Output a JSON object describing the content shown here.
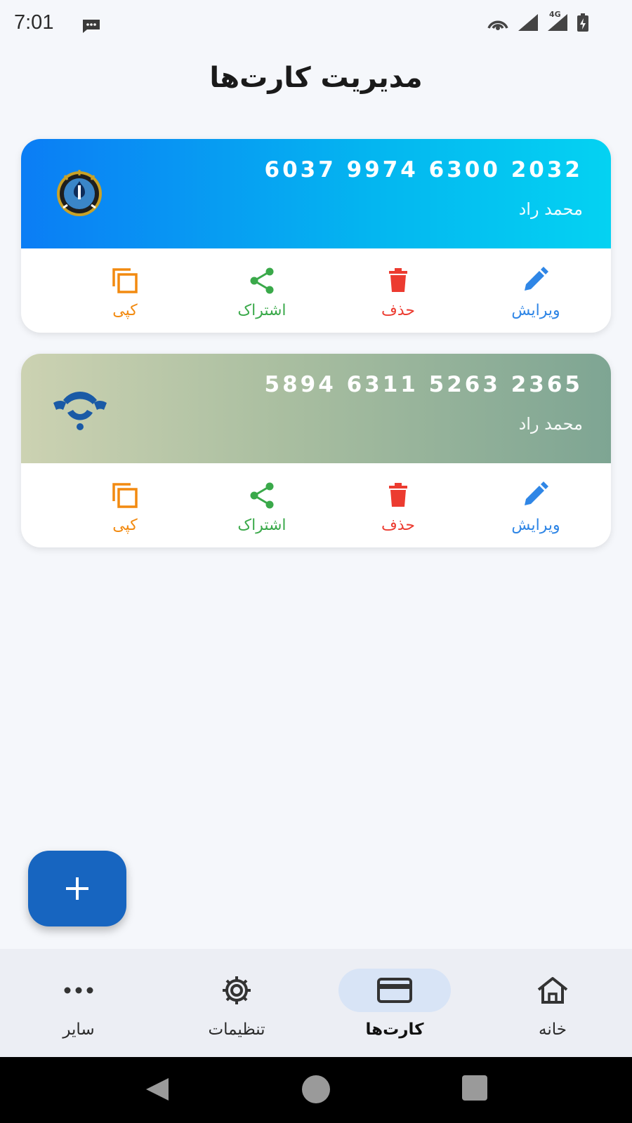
{
  "status_bar": {
    "time": "7:01",
    "network": "4G"
  },
  "page": {
    "title": "مدیریت کارت‌ها"
  },
  "cards": [
    {
      "number": "6037 9974 6300 2032",
      "holder": "محمد راد",
      "bank_logo": "bank-melli-logo"
    },
    {
      "number": "5894 6311 5263 2365",
      "holder": "محمد راد",
      "bank_logo": "bank-refah-logo"
    }
  ],
  "actions": {
    "edit": "ویرایش",
    "delete": "حذف",
    "share": "اشتراک",
    "copy": "کپی"
  },
  "fab": {
    "icon": "plus-icon"
  },
  "bottom_nav": {
    "items": [
      {
        "label": "خانه",
        "icon": "home-icon"
      },
      {
        "label": "کارت‌ها",
        "icon": "credit-card-icon",
        "active": true
      },
      {
        "label": "تنظیمات",
        "icon": "gear-icon"
      },
      {
        "label": "سایر",
        "icon": "more-horizontal-icon"
      }
    ]
  },
  "colors": {
    "edit": "#2f86e6",
    "delete": "#ec3b30",
    "share": "#3aa94a",
    "copy": "#f28a10",
    "fab": "#1765c0",
    "nav_active": "#d8e4f6"
  }
}
